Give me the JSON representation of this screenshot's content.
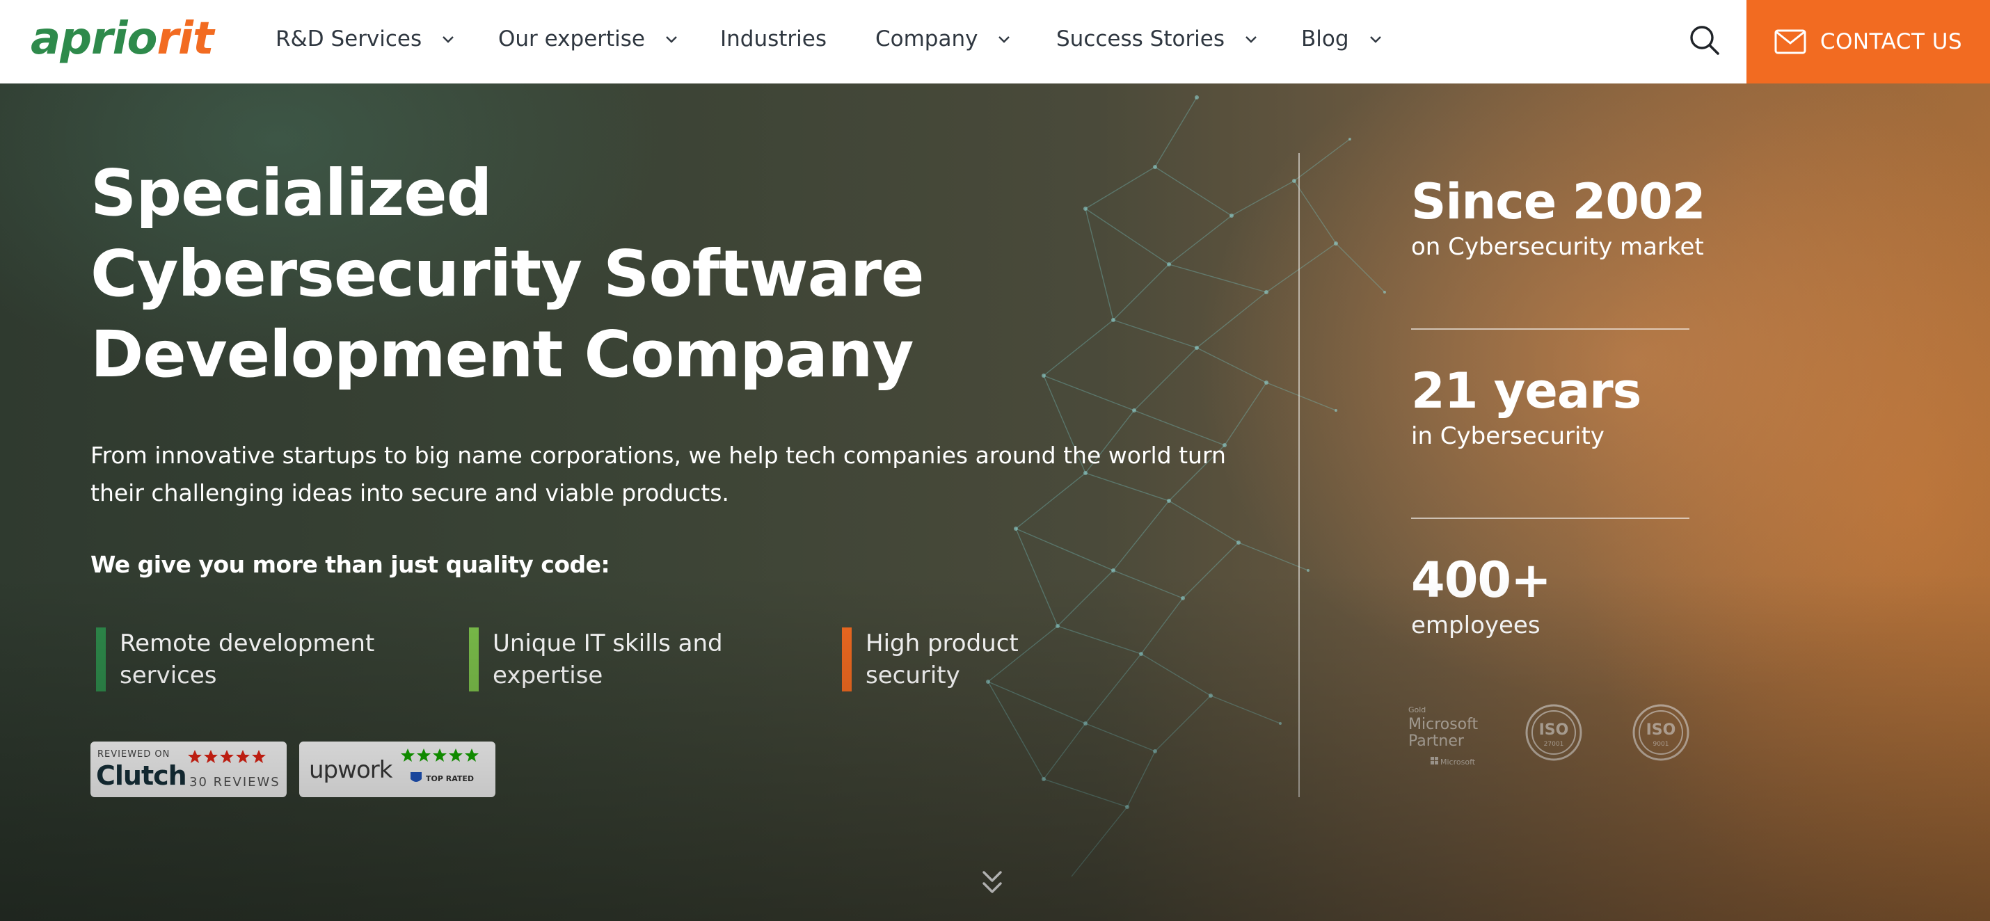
{
  "brand": {
    "logo_part1": "aprio",
    "logo_part2": "rit",
    "green": "#2e8a4b",
    "orange": "#f26b21"
  },
  "nav": {
    "items": [
      {
        "label": "R&D Services",
        "has_dropdown": true
      },
      {
        "label": "Our expertise",
        "has_dropdown": true
      },
      {
        "label": "Industries",
        "has_dropdown": false
      },
      {
        "label": "Company",
        "has_dropdown": true
      },
      {
        "label": "Success Stories",
        "has_dropdown": true
      },
      {
        "label": "Blog",
        "has_dropdown": true
      }
    ],
    "search_icon": "search-icon",
    "contact_label": "CONTACT US",
    "contact_icon": "mail-icon"
  },
  "hero": {
    "headline_lines": [
      "Specialized",
      "Cybersecurity Software",
      "Development Company"
    ],
    "subtext_lines": [
      "From innovative startups to big name corporations, we help tech companies around the world turn",
      "their challenging ideas into secure and viable products."
    ],
    "give_title": "We give you more than just quality code:",
    "features": [
      {
        "lines": [
          "Remote development",
          "services"
        ],
        "color": "#2e8a4b"
      },
      {
        "lines": [
          "Unique IT skills and",
          "expertise"
        ],
        "color": "#7cc04b"
      },
      {
        "lines": [
          "High product",
          "security"
        ],
        "color": "#f26b21"
      }
    ],
    "badges": {
      "clutch": {
        "reviewed_on": "REVIEWED ON",
        "name": "Clutch",
        "reviews": "30 REVIEWS"
      },
      "upwork": {
        "name": "upwork",
        "tag": "TOP RATED"
      }
    }
  },
  "stats": [
    {
      "value": "Since 2002",
      "label": "on Cybersecurity market"
    },
    {
      "value": "21 years",
      "label": "in Cybersecurity"
    },
    {
      "value": "400+",
      "label": "employees"
    }
  ],
  "certifications": {
    "microsoft": {
      "line1": "Gold",
      "line2": "Microsoft",
      "line3": "Partner",
      "line4": "Microsoft"
    },
    "iso1": {
      "name": "ISO",
      "number": "27001"
    },
    "iso2": {
      "name": "ISO",
      "number": "9001"
    }
  },
  "scroll_icon": "double-chevron-down-icon"
}
